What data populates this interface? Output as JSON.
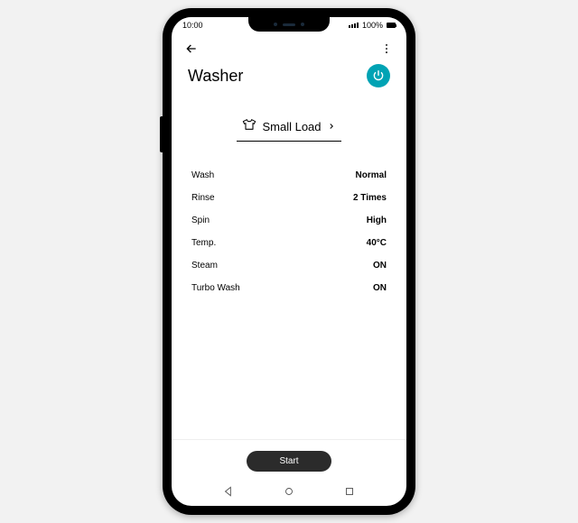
{
  "status": {
    "time": "10:00",
    "battery_pct": "100%"
  },
  "header": {
    "title": "Washer"
  },
  "mode": {
    "label": "Small Load"
  },
  "settings": [
    {
      "key": "Wash",
      "value": "Normal"
    },
    {
      "key": "Rinse",
      "value": "2 Times"
    },
    {
      "key": "Spin",
      "value": "High"
    },
    {
      "key": "Temp.",
      "value": "40°C"
    },
    {
      "key": "Steam",
      "value": "ON"
    },
    {
      "key": "Turbo Wash",
      "value": "ON"
    }
  ],
  "footer": {
    "start_label": "Start"
  }
}
